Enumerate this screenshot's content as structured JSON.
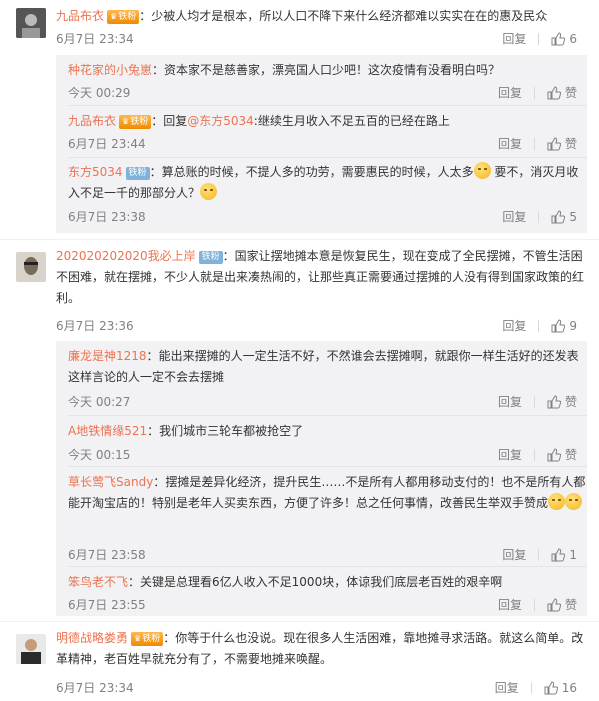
{
  "actions": {
    "reply": "回复",
    "like": "赞"
  },
  "comments": [
    {
      "user": "九品布衣",
      "badge": "铁粉",
      "badge_type": "gold",
      "text": "少被人均才是根本，所以人口不降下来什么经济都难以实实在在的惠及民众",
      "time": "6月7日 23:34",
      "likes": "6",
      "replies": [
        {
          "user": "种花家的小兔崽",
          "text": "资本家不是慈善家，漂亮国人口少吧！这次疫情有没看明白吗？",
          "time": "今天 00:29",
          "likes": "赞"
        },
        {
          "user": "九品布衣",
          "badge": "铁粉",
          "badge_type": "gold",
          "text_prefix": "回复",
          "mention": "@东方5034",
          "text": ":继续生月收入不足五百的已经在路上",
          "time": "6月7日 23:44",
          "likes": "赞"
        },
        {
          "user": "东方5034",
          "badge": "铁粉",
          "badge_type": "iron",
          "text": "算总账的时候，不提人多的功劳，需要惠民的时候，人太多",
          "text2": " 要不，消灭月收入不足一千的那部分人？",
          "time": "6月7日 23:38",
          "likes": "5"
        }
      ]
    },
    {
      "user": "202020202020我必上岸",
      "badge": "铁粉",
      "badge_type": "iron",
      "text": "国家让摆地摊本意是恢复民生，现在变成了全民摆摊，不管生活困不困难，就在摆摊，不少人就是出来凑热闹的，让那些真正需要通过摆摊的人没有得到国家政策的红利。",
      "time": "6月7日 23:36",
      "likes": "9",
      "replies": [
        {
          "user": "廉龙是神1218",
          "text": "能出来摆摊的人一定生活不好，不然谁会去摆摊啊，就跟你一样生活好的还发表这样言论的人一定不会去摆摊",
          "time": "今天 00:27",
          "likes": "赞"
        },
        {
          "user": "A地铁情缘521",
          "text": "我们城市三轮车都被抢空了",
          "time": "今天 00:15",
          "likes": "赞"
        },
        {
          "user": "草长莺飞Sandy",
          "text": "摆摊是差异化经济，提升民生……不是所有人都用移动支付的！也不是所有人都能开淘宝店的！特别是老年人买卖东西，方便了许多！总之任何事情，改善民生举双手赞成",
          "time": "6月7日 23:58",
          "likes": "1"
        },
        {
          "user": "笨鸟老不飞",
          "text": "关键是总理看6亿人收入不足1000块，体谅我们底层老百姓的艰辛啊",
          "time": "6月7日 23:55",
          "likes": "赞"
        }
      ]
    },
    {
      "user": "明德战略娄勇",
      "badge": "铁粉",
      "badge_type": "gold",
      "text": "你等于什么也没说。现在很多人生活困难，靠地摊寻求活路。就这么简单。改革精神，老百姓早就充分有了，不需要地摊来唤醒。",
      "time": "6月7日 23:34",
      "likes": "16",
      "replies": []
    }
  ]
}
